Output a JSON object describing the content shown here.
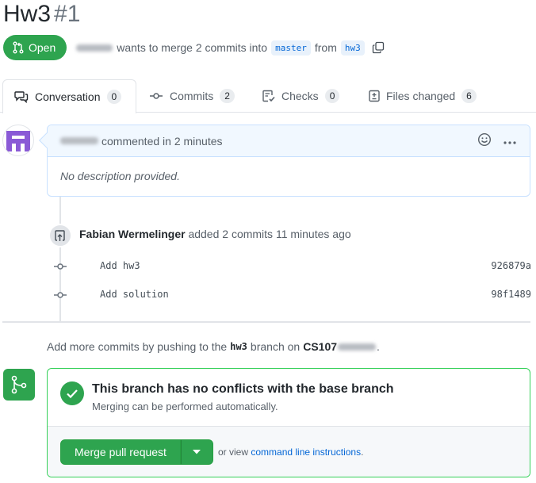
{
  "pr": {
    "title": "Hw3",
    "number": "#1",
    "state": "Open",
    "merge_text": "wants to merge 2 commits into",
    "base_branch": "master",
    "from_text": "from",
    "head_branch": "hw3"
  },
  "tabs": [
    {
      "label": "Conversation",
      "count": "0"
    },
    {
      "label": "Commits",
      "count": "2"
    },
    {
      "label": "Checks",
      "count": "0"
    },
    {
      "label": "Files changed",
      "count": "6"
    }
  ],
  "comment": {
    "action_text": "commented in 2 minutes",
    "body": "No description provided."
  },
  "commits_event": {
    "author": "Fabian Wermelinger",
    "text": "added 2 commits 11 minutes ago",
    "commits": [
      {
        "message": "Add hw3",
        "sha": "926879a"
      },
      {
        "message": "Add solution",
        "sha": "98f1489"
      }
    ]
  },
  "push_note": {
    "prefix": "Add more commits by pushing to the",
    "branch": "hw3",
    "middle": "branch on",
    "repo": "CS107",
    "suffix": "."
  },
  "merge": {
    "heading": "This branch has no conflicts with the base branch",
    "subtext": "Merging can be performed automatically.",
    "button_label": "Merge pull request",
    "or_text": "or view",
    "link_text": "command line instructions",
    "link_suffix": "."
  },
  "colors": {
    "success": "#2ea44f",
    "link": "#0366d6",
    "avatar": "#8a5ad6"
  }
}
